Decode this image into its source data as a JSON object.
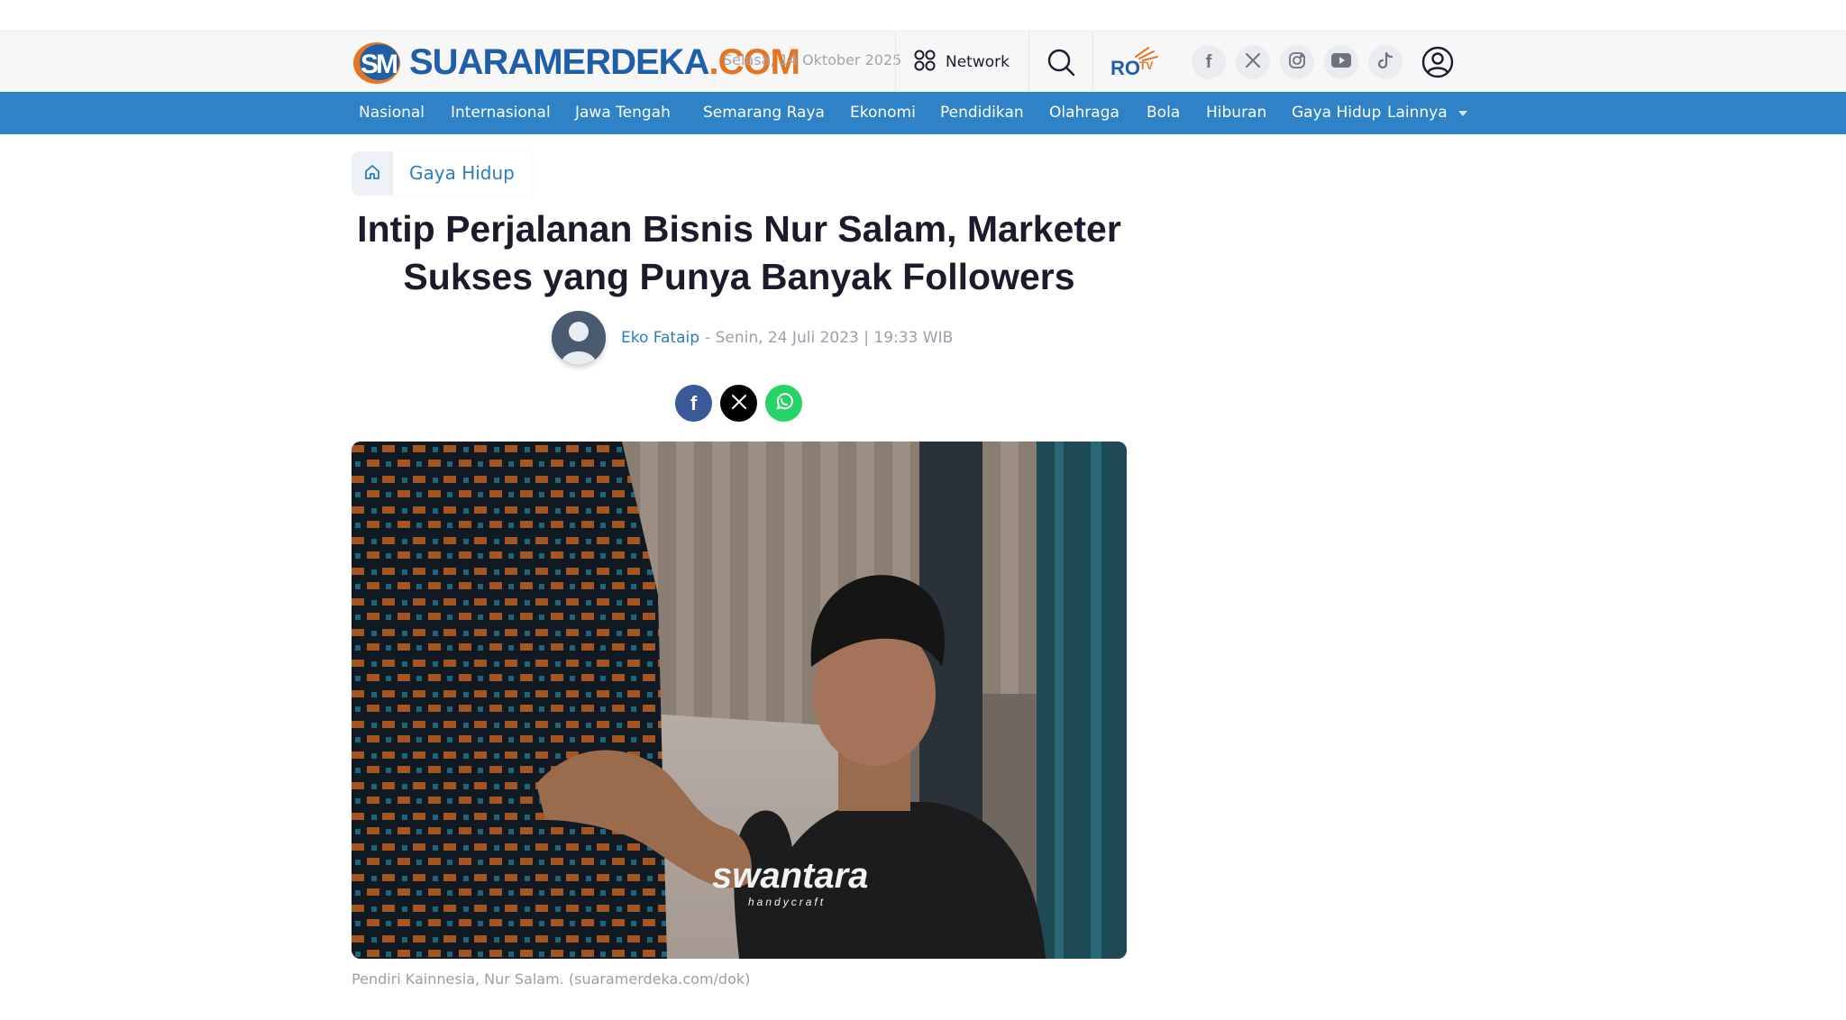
{
  "header": {
    "logo": {
      "main": "SUARAMERDEKA",
      "tld": ".COM",
      "mark": "SM"
    },
    "date": "Selasa, 14 Oktober 2025",
    "network_label": "Network",
    "rotv_label": "ROTV"
  },
  "social_links": [
    {
      "name": "facebook",
      "icon": "facebook-icon",
      "glyph": "f"
    },
    {
      "name": "x",
      "icon": "x-icon",
      "glyph": "𝕏"
    },
    {
      "name": "instagram",
      "icon": "instagram-icon"
    },
    {
      "name": "youtube",
      "icon": "youtube-icon"
    },
    {
      "name": "tiktok",
      "icon": "tiktok-icon",
      "glyph": "♪"
    }
  ],
  "nav": {
    "items": [
      "Nasional",
      "Internasional",
      "Jawa Tengah",
      "Semarang Raya",
      "Ekonomi",
      "Pendidikan",
      "Olahraga",
      "Bola",
      "Hiburan",
      "Gaya Hidup",
      "Lainnya"
    ]
  },
  "breadcrumb": {
    "category": "Gaya Hidup"
  },
  "article": {
    "headline": "Intip Perjalanan Bisnis Nur Salam, Marketer Sukses yang Punya Banyak Followers",
    "author": "Eko Fataip",
    "published": "- Senin, 24 Juli 2023 | 19:33 WIB",
    "image_shirt_text": "swantara",
    "image_shirt_sub": "handycraft",
    "caption": "Pendiri Kainnesia, Nur Salam. (suaramerdeka.com/dok)"
  },
  "share": [
    {
      "name": "facebook",
      "color": "#3b5998",
      "glyph": "f"
    },
    {
      "name": "x",
      "color": "#000000",
      "glyph": "𝕏"
    },
    {
      "name": "whatsapp",
      "color": "#25d366"
    }
  ],
  "colors": {
    "brand_blue": "#1f5ea8",
    "brand_orange": "#e57521",
    "nav_blue": "#2e82c5",
    "link_blue": "#2c7dbd"
  }
}
